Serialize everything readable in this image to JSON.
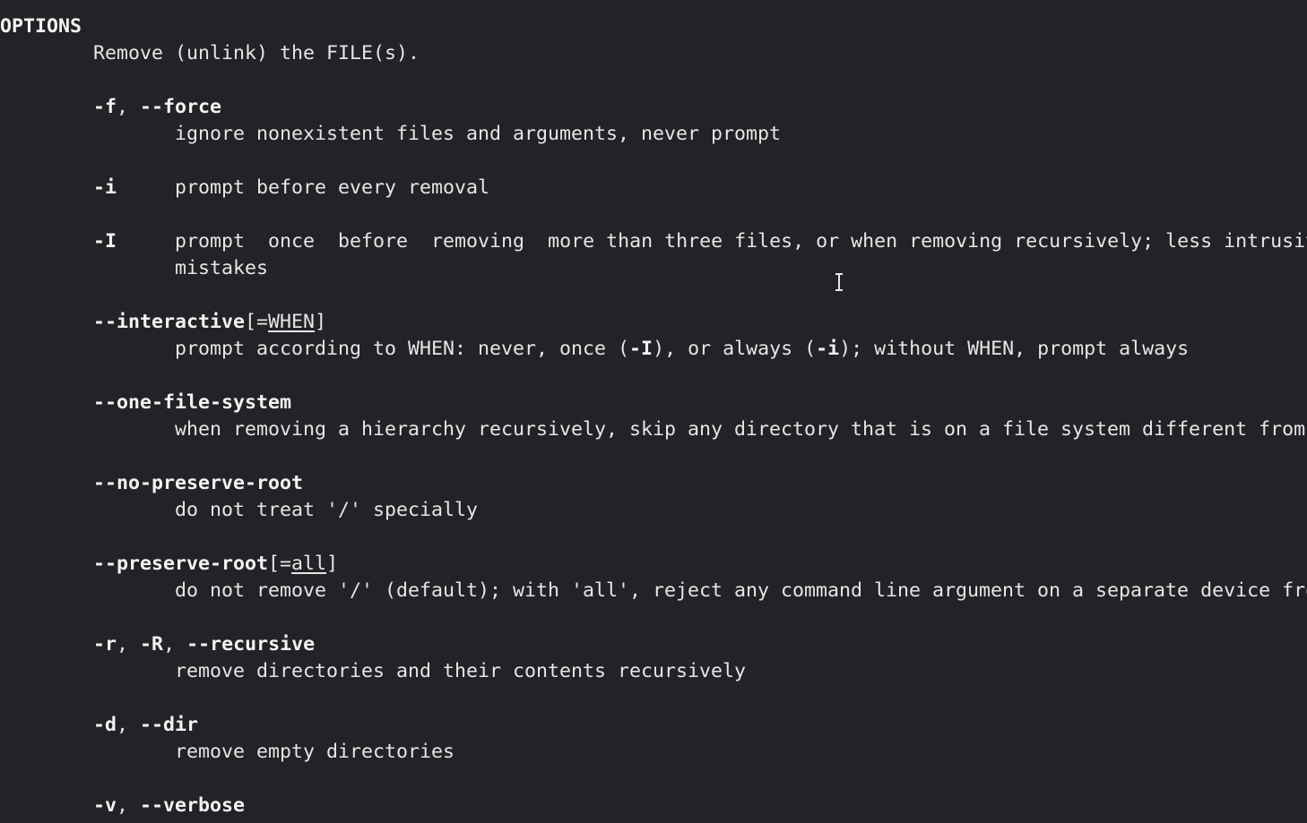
{
  "section": "OPTIONS",
  "intro": "Remove (unlink) the FILE(s).",
  "opt_force": {
    "flag1": "-f",
    "sep": ", ",
    "flag2": "--force",
    "desc": "ignore nonexistent files and arguments, never prompt"
  },
  "opt_i": {
    "flag": "-i",
    "desc": "prompt before every removal"
  },
  "opt_I": {
    "flag": "-I",
    "desc1": "prompt  once  before  removing  more than three files, or when removing recursively; less intrusiv",
    "desc2": "mistakes"
  },
  "opt_interactive": {
    "flag": "--interactive",
    "open": "[=",
    "arg": "WHEN",
    "close": "]",
    "desc_a": "prompt according to WHEN: never, once (",
    "desc_b": "-I",
    "desc_c": "), or always (",
    "desc_d": "-i",
    "desc_e": "); without WHEN, prompt always"
  },
  "opt_one_fs": {
    "flag": "--one-file-system",
    "desc": "when removing a hierarchy recursively, skip any directory that is on a file system different from"
  },
  "opt_no_preserve": {
    "flag": "--no-preserve-root",
    "desc": "do not treat '/' specially"
  },
  "opt_preserve": {
    "flag": "--preserve-root",
    "open": "[=",
    "arg": "all",
    "close": "]",
    "desc": "do not remove '/' (default); with 'all', reject any command line argument on a separate device fro"
  },
  "opt_recursive": {
    "flag1": "-r",
    "sep1": ", ",
    "flag2": "-R",
    "sep2": ", ",
    "flag3": "--recursive",
    "desc": "remove directories and their contents recursively"
  },
  "opt_dir": {
    "flag1": "-d",
    "sep": ", ",
    "flag2": "--dir",
    "desc": "remove empty directories"
  },
  "opt_verbose": {
    "flag1": "-v",
    "sep": ", ",
    "flag2": "--verbose"
  }
}
